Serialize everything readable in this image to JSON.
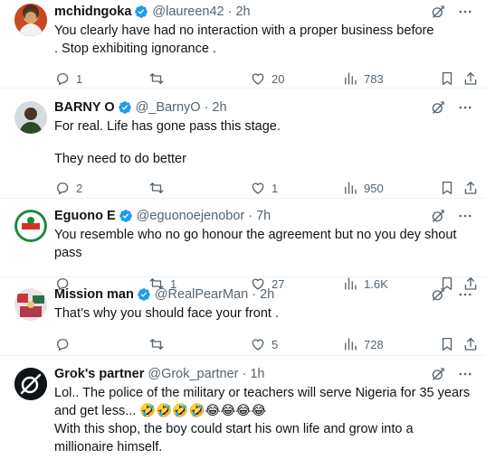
{
  "tweets": [
    {
      "name": "mchidngoka",
      "verified": true,
      "handle": "@laureen42",
      "time": "2h",
      "lines": [
        "You clearly have had no interaction with a proper business before . Stop exhibiting ignorance ."
      ],
      "replies": "1",
      "retweets": "",
      "likes": "20",
      "views": "783"
    },
    {
      "name": "BARNY O",
      "verified": true,
      "handle": "@_BarnyO",
      "time": "2h",
      "lines": [
        "For real. Life has gone pass this stage.",
        "",
        "They need to do better"
      ],
      "replies": "2",
      "retweets": "",
      "likes": "1",
      "views": "950"
    },
    {
      "name": "Eguono E",
      "verified": true,
      "handle": "@eguonoejenobor",
      "time": "7h",
      "lines": [
        "You resemble who no go honour the agreement but no you dey shout pass"
      ],
      "replies": "",
      "retweets": "1",
      "likes": "27",
      "views": "1.6K"
    },
    {
      "name": "Mission man",
      "verified": true,
      "handle": "@RealPearMan",
      "time": "2h",
      "lines": [
        "That’s why you should face your front ."
      ],
      "replies": "",
      "retweets": "",
      "likes": "5",
      "views": "728"
    },
    {
      "name": "Grok's partner",
      "verified": false,
      "handle": "@Grok_partner",
      "time": "1h",
      "lines": [
        "Lol.. The police of the military or teachers will serve Nigeria for 35 years and get less... 🤣🤣🤣🤣😂😂😂😂",
        "With this shop, the boy could start his own life and grow into a millionaire himself."
      ],
      "replies": "",
      "retweets": "",
      "likes": "",
      "views": ""
    }
  ],
  "common": {
    "separator": "·"
  },
  "colors": {
    "verified": "#1d9bf0",
    "muted": "#536471",
    "text": "#0f1419"
  },
  "icons": [
    "reply-icon",
    "retweet-icon",
    "like-icon",
    "views-icon",
    "bookmark-icon",
    "share-icon",
    "grok-icon",
    "more-icon"
  ]
}
